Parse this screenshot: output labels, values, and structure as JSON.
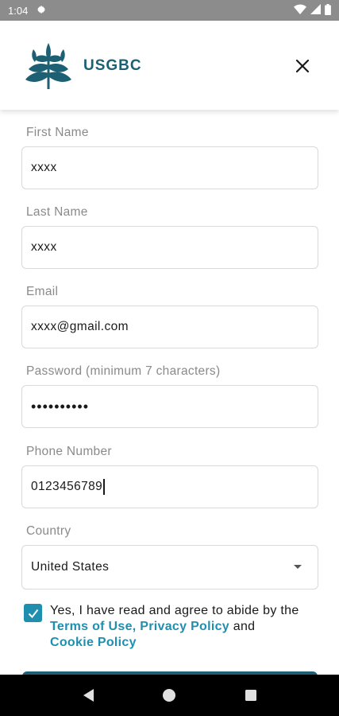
{
  "status_bar": {
    "time": "1:04",
    "icons": [
      "gear-icon",
      "wifi-icon",
      "signal-icon",
      "battery-icon"
    ]
  },
  "header": {
    "brand": "USGBC",
    "logo_icon": "usgbc-leaf-logo",
    "close_icon": "close-icon"
  },
  "form": {
    "first_name": {
      "label": "First Name",
      "value": "xxxx"
    },
    "last_name": {
      "label": "Last Name",
      "value": "xxxx"
    },
    "email": {
      "label": "Email",
      "value": "xxxx@gmail.com"
    },
    "password": {
      "label": "Password (minimum 7 characters)",
      "value": "••••••••••"
    },
    "phone": {
      "label": "Phone Number",
      "value": "0123456789"
    },
    "country": {
      "label": "Country",
      "value": "United States"
    }
  },
  "agreement": {
    "checked": true,
    "text_before": "Yes, I have read and agree to abide by the ",
    "terms": "Terms of Use,",
    "privacy": "Privacy Policy",
    "and": " and ",
    "cookie": "Cookie Policy"
  },
  "colors": {
    "brand": "#1d5f73",
    "accent": "#1f8fb0"
  },
  "nav": {
    "icons": [
      "back-icon",
      "home-icon",
      "recents-icon"
    ]
  }
}
